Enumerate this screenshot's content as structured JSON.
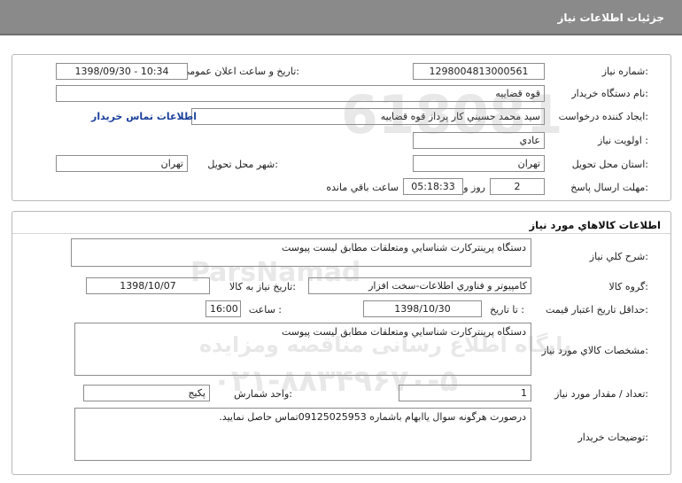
{
  "header": {
    "title": "جزئيات اطلاعات نياز"
  },
  "details": {
    "need_number_label": "شماره نياز:",
    "need_number": "1298004813000561",
    "announce_label": "تاريخ و ساعت اعلان عمومي:",
    "announce_value": "1398/09/30 - 10:34",
    "buyer_org_label": "نام دستگاه خريدار:",
    "buyer_org": "قوه قضاييه",
    "creator_label": "ايجاد کننده درخواست:",
    "creator": "سيد محمد حسيني کار پرداز  قوه قضاييه",
    "contact_link": "اطلاعات تماس خريدار",
    "priority_label": "اولويت نياز :",
    "priority": "عادي",
    "province_label": "استان محل تحويل:",
    "province": "تهران",
    "city_label": "شهر محل تحويل:",
    "city": "تهران",
    "deadline_label": "مهلت ارسال پاسخ:",
    "deadline_days": "2",
    "days_word": "روز و",
    "deadline_time": "05:18:33",
    "remaining_word": "ساعت باقي مانده"
  },
  "goods": {
    "section_title": "اطلاعات کالاهاي مورد نياز",
    "general_desc_label": "شرح کلي نياز:",
    "general_desc": "دستگاه پرينتركارت شناسايي ومتعلقات مطابق ليست پيوست",
    "group_label": "گروه کالا:",
    "group": "کامپيوتر و فناوري اطلاعات-سخت افزار",
    "need_date_label": "تاريخ نياز به کالا:",
    "need_date": "1398/10/07",
    "min_validity_label": "حداقل تاريخ اعتبار قيمت:",
    "until_date_label": "تا تاريخ :",
    "until_date": "1398/10/30",
    "hour_label": "ساعت :",
    "hour": "16:00",
    "specs_label": "مشخصات کالاي مورد نياز:",
    "specs": "دستگاه پرينتركارت شناسايي ومتعلقات مطابق ليست پيوست",
    "qty_label": "تعداد / مقدار مورد نياز:",
    "qty": "1",
    "unit_label": "واحد شمارش:",
    "unit": "پکيج",
    "buyer_notes_label": "توضيحات خريدار:",
    "buyer_notes": "درصورت هرگونه سوال یاابهام باشماره 09125025953تماس حاصل نمایید."
  },
  "watermark": {
    "line1": "618081",
    "brand": "ParsNamad",
    "line2": "پایگاه اطلاع رسانی مناقصه ومزایده",
    "phone": "۰۲۱-۸۸۳۴۹۶۷۰-۵"
  }
}
